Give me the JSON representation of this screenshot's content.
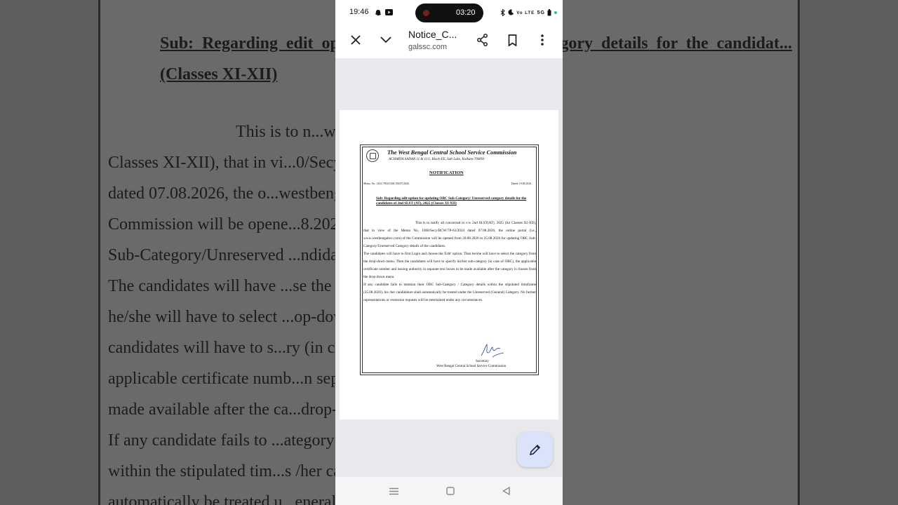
{
  "backdrop": {
    "subject": "Sub: Regarding edit op... Category/ Unreserved category details for the candidat... (Classes XI-XII)",
    "lines": [
      "This is to n...w 2nd SLST(AT), 2025 (for",
      "Classes XI-XII), that in vi...0/Secy/BCW/7P-63/2024",
      "dated 07.08.2026, the o...westbengalssc.com) of the",
      "Commission will be opene...8.2026 for updating OBC",
      "Sub-Category/Unreserved ...ndidates.",
      "The candidates will have ...se the 'Edit' option. Then",
      "he/she will have to select ...op-down menu. Then the",
      "candidates will have to s...ry (in case of OBC), the",
      "applicable certificate numb...n separate text boxes to be",
      "made available after the ca...drop-down menu.",
      "If any candidate fails to ...ategory / Category details",
      "within the stipulated tim...s /her candidature shall",
      "automatically be treated u...eneral) Category. No further"
    ]
  },
  "status_bar": {
    "time": "19:46",
    "recording_time": "03:20",
    "left_icons": "snapchat, youtube",
    "right_icons": "bluetooth, moon, volte, 5G, battery"
  },
  "app_bar": {
    "title": "Notice_C...",
    "domain": "galssc.com"
  },
  "notice": {
    "org_name": "The West Bengal Central School Service Commission",
    "address": "ACHARYA SADAN 11 & 11/1, Block-EE, Salt Lake, Kolkata-700091",
    "heading": "NOTIFICATION",
    "memo": "Memo. No. 1454 /7816/CSSC/ESTT/2026",
    "date": "Dated: 19.08.2026",
    "subject": "Sub: Regarding edit option for updating OBC Sub-Category/ Unreserved category details for the candidates of 2nd SLST (AT), 2025 (Classes XI-XII)",
    "para1": "This is to notify all concerned in c/w 2nd SLST(AT), 2025 (for Classes XI-XII), that in view of the Memo No. 1060/Secy/BCW/7P-63/2024 dated 07.08.2026, the online portal (i.e., www.westbengalssc.com) of the Commission will be opened from 20.08.2026 to 25.08.2026 for updating OBC Sub-Category/Unreserved Category details of the candidates.",
    "para2": "The candidates will have to first Login and choose the 'Edit' option. Then he/she will have to select the category from the drop-down menu. Then the candidates will have to specify his/her sub-category (in case of OBC), the applicable certificate number and issuing authority in separate text boxes to be made available after the category is chosen from the drop-down menu.",
    "para3": "If any candidate fails to mention their OBC Sub-Category / Category details within the stipulated timeframe (25.08.2026), his /her candidature shall automatically be treated under the Unreserved (General) Category. No further representations or extension requests will be entertained under any circumstances.",
    "signatory": "Secretary",
    "signatory_org": "West Bengal Central School Service Commission"
  },
  "icons": {
    "close": "close-icon",
    "expand": "chevron-down-icon",
    "share": "share-icon",
    "bookmark": "bookmark-icon",
    "more": "more-vert-icon",
    "edit": "pencil-icon"
  }
}
